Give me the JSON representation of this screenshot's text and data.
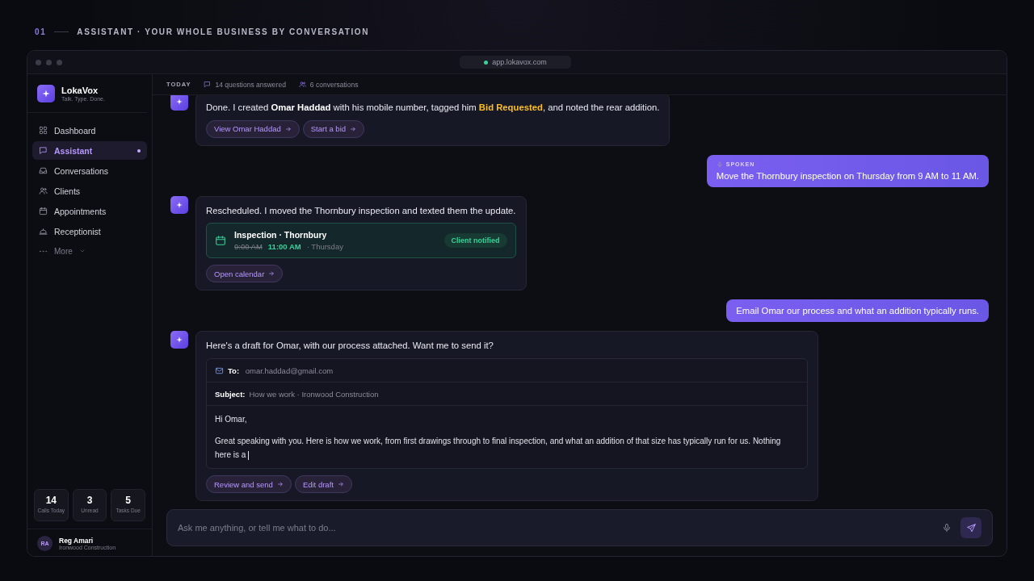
{
  "header": {
    "number": "01",
    "title": "ASSISTANT · YOUR WHOLE BUSINESS BY CONVERSATION"
  },
  "browser": {
    "url": "app.lokavox.com"
  },
  "sidebar": {
    "brand": {
      "name": "LokaVox",
      "tagline": "Talk. Type. Done."
    },
    "items": [
      {
        "label": "Dashboard",
        "selected": false,
        "dot": false
      },
      {
        "label": "Assistant",
        "selected": true,
        "dot": true
      },
      {
        "label": "Conversations",
        "selected": false,
        "dot": false
      },
      {
        "label": "Clients",
        "selected": false,
        "dot": false
      },
      {
        "label": "Appointments",
        "selected": false,
        "dot": false
      },
      {
        "label": "Receptionist",
        "selected": false,
        "dot": false
      }
    ],
    "more": "More",
    "stats": [
      {
        "value": "14",
        "label": "Calls Today"
      },
      {
        "value": "3",
        "label": "Unread"
      },
      {
        "value": "5",
        "label": "Tasks Due"
      }
    ],
    "user": {
      "initials": "RA",
      "name": "Reg Amari",
      "company": "Ironwood Construction"
    }
  },
  "topbar": {
    "day": "TODAY",
    "questions": "14 questions answered",
    "conversations": "6 conversations"
  },
  "messages": [
    {
      "kind": "assistant",
      "segments": [
        {
          "kind": "plain",
          "text": "Done. I created "
        },
        {
          "kind": "bold",
          "text": "Omar Haddad"
        },
        {
          "kind": "plain",
          "text": " with his mobile number, tagged him "
        },
        {
          "kind": "tag",
          "text": "Bid Requested"
        },
        {
          "kind": "plain",
          "text": ", and noted the rear addition."
        }
      ],
      "actions": [
        "View Omar Haddad",
        "Start a bid"
      ]
    },
    {
      "kind": "user",
      "tag": "SPOKEN",
      "text": "Move the Thornbury inspection on Thursday from 9 AM to 11 AM."
    },
    {
      "kind": "assistant",
      "segments": [
        {
          "kind": "plain",
          "text": "Rescheduled. I moved the Thornbury inspection and texted them the update."
        }
      ],
      "card": {
        "kind": "appointment",
        "title": "Inspection · Thornbury",
        "old_time": "9:00 AM",
        "new_time": "11:00 AM",
        "day": "· Thursday",
        "status": "Client notified"
      },
      "actions": [
        "Open calendar"
      ]
    },
    {
      "kind": "user",
      "text": "Email Omar our process and what an addition typically runs."
    },
    {
      "kind": "assistant",
      "segments": [
        {
          "kind": "plain",
          "text": "Here's a draft for Omar, with our process attached. Want me to send it?"
        }
      ],
      "card": {
        "kind": "email",
        "to_label": "To:",
        "to": "omar.haddad@gmail.com",
        "subject_label": "Subject:",
        "subject": "How we work · Ironwood Construction",
        "body": [
          "Hi Omar,",
          "Great speaking with you. Here is how we work, from first drawings through to final inspection, and what an addition of that size has typically run for us. Nothing here is a"
        ]
      },
      "actions": [
        "Review and send",
        "Edit draft"
      ]
    }
  ],
  "composer": {
    "placeholder": "Ask me anything, or tell me what to do..."
  }
}
